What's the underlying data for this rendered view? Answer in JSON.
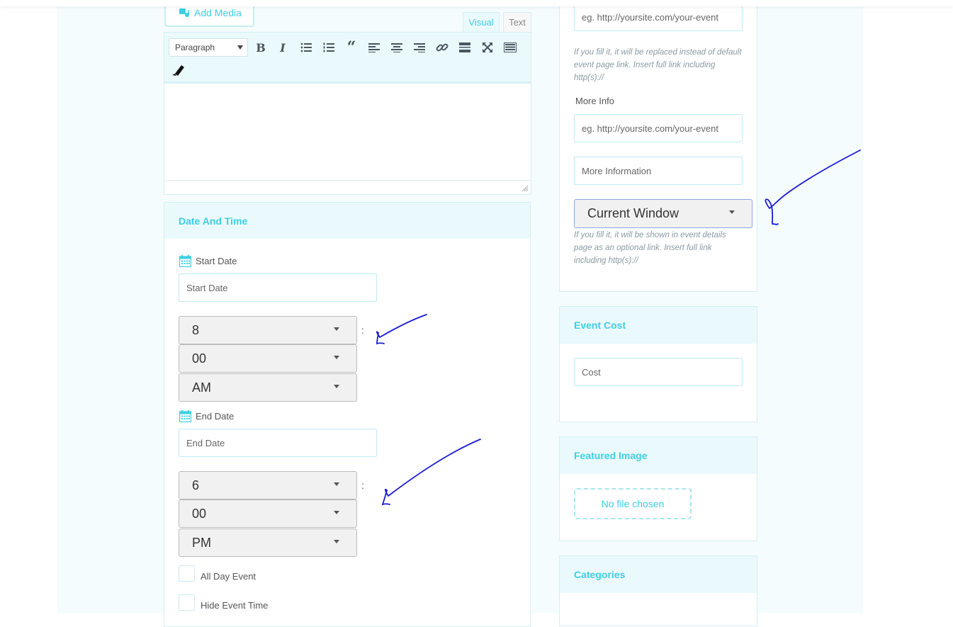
{
  "editor": {
    "add_media_label": "Add Media",
    "tab_visual": "Visual",
    "tab_text": "Text",
    "format_select_value": "Paragraph"
  },
  "date_time": {
    "title": "Date And Time",
    "start_date_label": "Start Date",
    "start_date_placeholder": "Start Date",
    "start_hour": "8",
    "start_minute": "00",
    "start_ampm": "AM",
    "end_date_label": "End Date",
    "end_date_placeholder": "End Date",
    "end_hour": "6",
    "end_minute": "00",
    "end_ampm": "PM",
    "colon": ":",
    "all_day_label": "All Day Event",
    "hide_time_label": "Hide Event Time"
  },
  "links": {
    "event_link_placeholder": "eg. http://yoursite.com/your-event",
    "event_link_hint": "If you fill it, it will be replaced instead of default event page link. Insert full link including http(s)://",
    "more_info_label": "More Info",
    "more_info_placeholder": "eg. http://yoursite.com/your-event",
    "more_info_title_placeholder": "More Information",
    "target_select_value": "Current Window",
    "more_info_hint": "If you fill it, it will be shown in event details page as an optional link. Insert full link including http(s)://"
  },
  "cost": {
    "title": "Event Cost",
    "placeholder": "Cost"
  },
  "featured_image": {
    "title": "Featured Image",
    "button_label": "No file chosen"
  },
  "categories": {
    "title": "Categories"
  },
  "colors": {
    "accent": "#3fcde3",
    "panel_header_bg": "#eafafc",
    "annotation_ink": "#1a1ad6"
  }
}
